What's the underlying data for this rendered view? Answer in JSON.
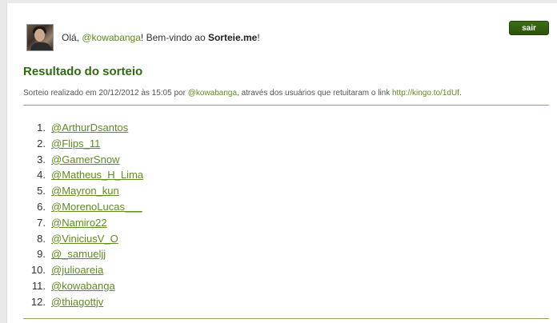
{
  "header": {
    "greeting_prefix": "Olá, ",
    "username": "@kowabanga",
    "greeting_middle": "! Bem-vindo ao ",
    "site_name": "Sorteie.me",
    "greeting_suffix": "!"
  },
  "logout_button": "sair",
  "result": {
    "title": "Resultado do sorteio",
    "meta_prefix": "Sorteio realizado em 20/12/2012 às 15:05 por ",
    "meta_user": "@kowabanga",
    "meta_middle": ", através dos usuários que retuitaram o link ",
    "meta_link": "http://kingo.to/1dUf",
    "meta_suffix": "."
  },
  "winners": [
    {
      "num": "1.",
      "name": "@ArthurDsantos"
    },
    {
      "num": "2.",
      "name": "@Flips_11"
    },
    {
      "num": "3.",
      "name": "@GamerSnow"
    },
    {
      "num": "4.",
      "name": "@Matheus_H_Lima"
    },
    {
      "num": "5.",
      "name": "@Mayron_kun"
    },
    {
      "num": "6.",
      "name": "@MorenoLucas___"
    },
    {
      "num": "7.",
      "name": "@Namiro22"
    },
    {
      "num": "8.",
      "name": "@ViniciusV_O"
    },
    {
      "num": "9.",
      "name": "@_samueljj"
    },
    {
      "num": "10.",
      "name": "@julioareia"
    },
    {
      "num": "11.",
      "name": "@kowabanga"
    },
    {
      "num": "12.",
      "name": "@thiagottjv"
    }
  ],
  "colors": {
    "accent_green": "#5e8c1f",
    "title_green": "#2f6b0e",
    "button_green": "#2b5209"
  }
}
